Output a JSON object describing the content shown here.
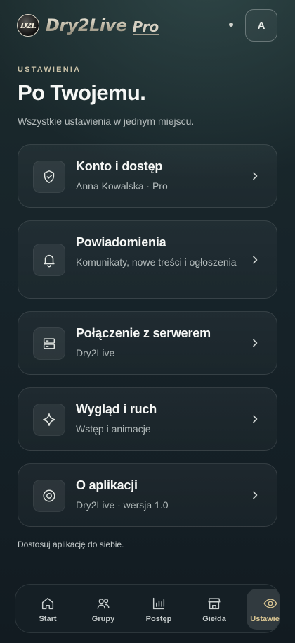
{
  "header": {
    "brand_mark": "D2L",
    "brand_word": "Dry2Live",
    "brand_suffix": "Pro",
    "avatar_initial": "A"
  },
  "page": {
    "eyebrow": "USTAWIENIA",
    "title": "Po Twojemu.",
    "subtitle": "Wszystkie ustawienia w jednym miejscu.",
    "footnote": "Dostosuj aplikację do siebie."
  },
  "cards": [
    {
      "icon": "shield-check-icon",
      "title": "Konto i dostęp",
      "desc": "Anna Kowalska · Pro"
    },
    {
      "icon": "bell-icon",
      "title": "Powiadomienia",
      "desc": "Komunikaty, nowe treści i ogłoszenia"
    },
    {
      "icon": "server-icon",
      "title": "Połączenie z serwerem",
      "desc": "Dry2Live"
    },
    {
      "icon": "sparkle-icon",
      "title": "Wygląd i ruch",
      "desc": "Wstęp i animacje"
    },
    {
      "icon": "info-circle-icon",
      "title": "O aplikacji",
      "desc": "Dry2Live · wersja 1.0"
    }
  ],
  "tabs": [
    {
      "icon": "home-icon",
      "label": "Start"
    },
    {
      "icon": "users-icon",
      "label": "Grupy"
    },
    {
      "icon": "bar-chart-icon",
      "label": "Postęp"
    },
    {
      "icon": "store-icon",
      "label": "Giełda"
    },
    {
      "icon": "settings-eye-icon",
      "label": "Ustawienia",
      "active": true
    }
  ],
  "colors": {
    "accent_gold": "#d9c592",
    "background": "#17242a",
    "text": "#f6f7f5"
  }
}
